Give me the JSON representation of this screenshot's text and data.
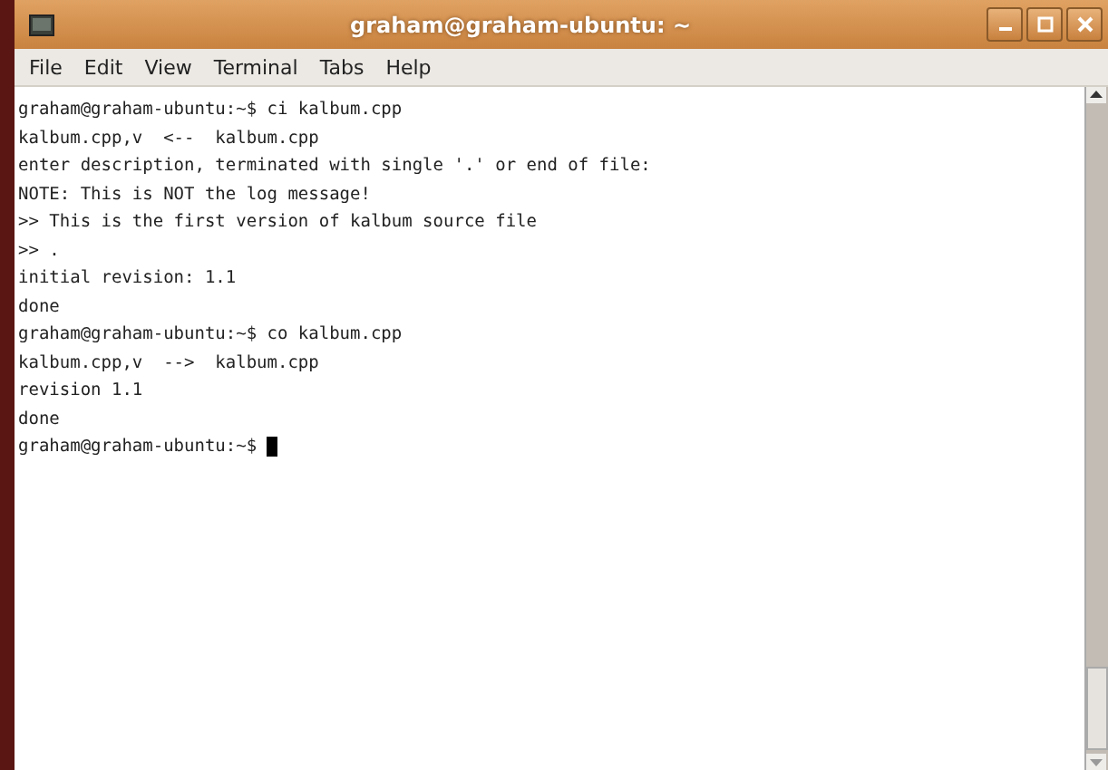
{
  "window": {
    "title": "graham@graham-ubuntu: ~"
  },
  "menu": [
    "File",
    "Edit",
    "View",
    "Terminal",
    "Tabs",
    "Help"
  ],
  "terminal": {
    "lines": [
      "graham@graham-ubuntu:~$ ci kalbum.cpp",
      "kalbum.cpp,v  <--  kalbum.cpp",
      "enter description, terminated with single '.' or end of file:",
      "NOTE: This is NOT the log message!",
      ">> This is the first version of kalbum source file",
      ">> .",
      "initial revision: 1.1",
      "done",
      "graham@graham-ubuntu:~$ co kalbum.cpp",
      "kalbum.cpp,v  -->  kalbum.cpp",
      "revision 1.1",
      "done"
    ],
    "prompt": "graham@graham-ubuntu:~$ "
  }
}
